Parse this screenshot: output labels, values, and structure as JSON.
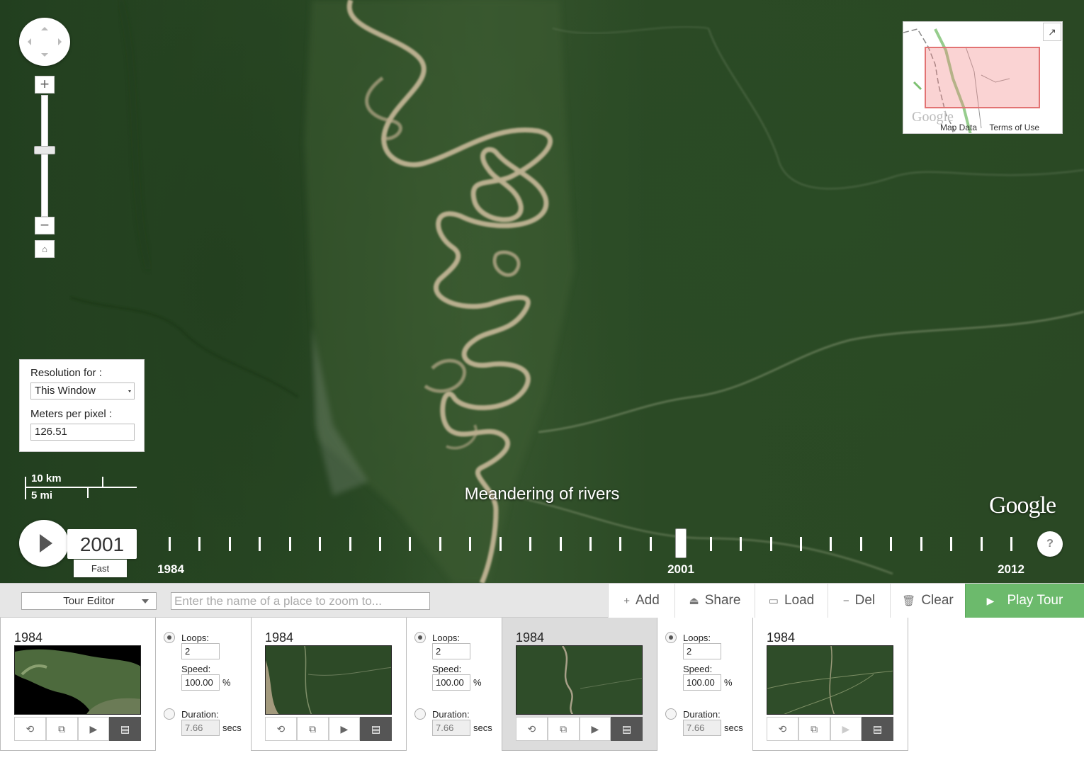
{
  "map": {
    "caption": "Meandering of rivers",
    "google_logo": "Google",
    "nav": {
      "zoom_in": "+",
      "zoom_out": "−",
      "home": "⌂"
    },
    "resolution": {
      "label": "Resolution for :",
      "selected": "This Window",
      "meters_label": "Meters per pixel :",
      "meters_value": "126.51"
    },
    "scale": {
      "km": "10 km",
      "mi": "5 mi"
    },
    "minimap": {
      "map_data": "Map Data",
      "terms": "Terms of Use",
      "google": "Google",
      "expand_icon": "expand-icon"
    },
    "timeline": {
      "current_year": "2001",
      "speed": "Fast",
      "start_label": "1984",
      "mid_label": "2001",
      "end_label": "2012",
      "tick_count": 29,
      "current_index": 17,
      "help": "?"
    }
  },
  "toolbar": {
    "mode": "Tour Editor",
    "search_placeholder": "Enter the name of a place to zoom to...",
    "add": "Add",
    "share": "Share",
    "load": "Load",
    "del": "Del",
    "clear": "Clear",
    "play_tour": "Play Tour"
  },
  "tour": {
    "keyframes": [
      {
        "year": "1984"
      },
      {
        "year": "1984"
      },
      {
        "year": "1984"
      },
      {
        "year": "1984"
      }
    ],
    "transitions": [
      {
        "loops_label": "Loops:",
        "loops": "2",
        "speed_label": "Speed:",
        "speed": "100.00",
        "speed_unit": "%",
        "duration_label": "Duration:",
        "duration": "7.66",
        "duration_unit": "secs"
      },
      {
        "loops_label": "Loops:",
        "loops": "2",
        "speed_label": "Speed:",
        "speed": "100.00",
        "speed_unit": "%",
        "duration_label": "Duration:",
        "duration": "7.66",
        "duration_unit": "secs"
      },
      {
        "loops_label": "Loops:",
        "loops": "2",
        "speed_label": "Speed:",
        "speed": "100.00",
        "speed_unit": "%",
        "duration_label": "Duration:",
        "duration": "7.66",
        "duration_unit": "secs"
      }
    ]
  }
}
